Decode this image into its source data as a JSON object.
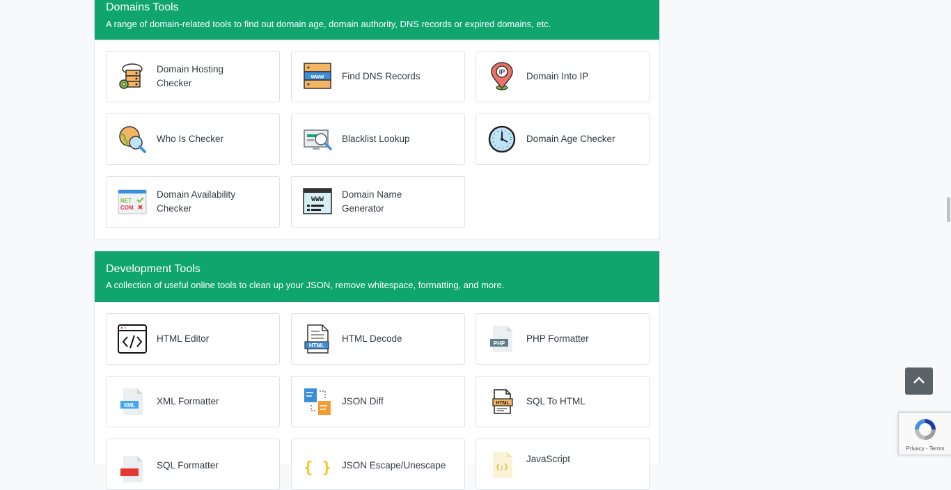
{
  "domains_section": {
    "title": "Domains Tools",
    "subtitle": "A range of domain-related tools to find out domain age, domain authority, DNS records or expired domains, etc.",
    "tools": [
      {
        "label": "Domain Hosting Checker",
        "icon": "hosting-server-icon"
      },
      {
        "label": "Find DNS Records",
        "icon": "dns-server-icon"
      },
      {
        "label": "Domain Into IP",
        "icon": "ip-pin-icon"
      },
      {
        "label": "Who Is Checker",
        "icon": "globe-search-icon"
      },
      {
        "label": "Blacklist Lookup",
        "icon": "monitor-search-icon"
      },
      {
        "label": "Domain Age Checker",
        "icon": "clock-icon"
      },
      {
        "label": "Domain Availability Checker",
        "icon": "domain-extension-icon",
        "icon_text_1": "NET",
        "icon_text_2": "COM"
      },
      {
        "label": "Domain Name Generator",
        "icon": "www-window-icon",
        "icon_text": "WWW"
      }
    ]
  },
  "development_section": {
    "title": "Development Tools",
    "subtitle": "A collection of useful online tools to clean up your JSON, remove whitespace, formatting, and more.",
    "tools": [
      {
        "label": "HTML Editor",
        "icon": "code-window-icon"
      },
      {
        "label": "HTML Decode",
        "icon": "html-file-icon",
        "icon_text": "HTML"
      },
      {
        "label": "PHP Formatter",
        "icon": "php-file-icon",
        "icon_text": "PHP"
      },
      {
        "label": "XML Formatter",
        "icon": "xml-file-icon",
        "icon_text": "XML"
      },
      {
        "label": "JSON Diff",
        "icon": "json-diff-icon"
      },
      {
        "label": "SQL To HTML",
        "icon": "html-page-icon",
        "icon_text": "HTML"
      },
      {
        "label": "SQL Formatter",
        "icon": "sql-file-icon"
      },
      {
        "label": "JSON Escape/Unescape",
        "icon": "braces-icon"
      },
      {
        "label": "JavaScript",
        "icon": "js-file-icon"
      }
    ]
  },
  "recaptcha": {
    "footer": "Privacy - Terms"
  },
  "colors": {
    "accent": "#0fa56d",
    "scroll_button": "#5a6268"
  }
}
